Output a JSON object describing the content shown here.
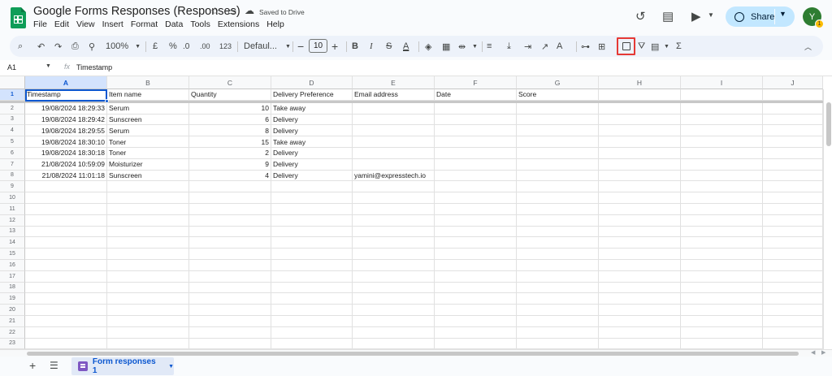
{
  "header": {
    "title": "Google Forms Responses (Responses)",
    "saved_status": "Saved to Drive",
    "share_label": "Share",
    "avatar_initial": "Y",
    "avatar_badge": "1",
    "menu": [
      "File",
      "Edit",
      "View",
      "Insert",
      "Format",
      "Data",
      "Tools",
      "Extensions",
      "Help"
    ]
  },
  "toolbar": {
    "zoom": "100%",
    "currency": "£",
    "percent": "%",
    "decimal_decrease": ".0",
    "decimal_increase": ".00",
    "more_formats": "123",
    "font_family": "Defaul...",
    "font_size": "10",
    "minus": "−",
    "plus": "+"
  },
  "formula_bar": {
    "cell_ref": "A1",
    "fx": "fx",
    "value": "Timestamp"
  },
  "grid": {
    "columns": [
      "A",
      "B",
      "C",
      "D",
      "E",
      "F",
      "G",
      "H",
      "I",
      "J"
    ],
    "headers": [
      "Timestamp",
      "Item name",
      "Quantity",
      "Delivery Preference",
      "Email address",
      "Date",
      "Score"
    ],
    "rows": [
      [
        "19/08/2024 18:29:33",
        "Serum",
        "10",
        "Take away",
        ""
      ],
      [
        "19/08/2024 18:29:42",
        "Sunscreen",
        "6",
        "Delivery",
        ""
      ],
      [
        "19/08/2024 18:29:55",
        "Serum",
        "8",
        "Delivery",
        ""
      ],
      [
        "19/08/2024 18:30:10",
        "Toner",
        "15",
        "Take away",
        ""
      ],
      [
        "19/08/2024 18:30:18",
        "Toner",
        "2",
        "Delivery",
        ""
      ],
      [
        "21/08/2024 10:59:09",
        "Moisturizer",
        "9",
        "Delivery",
        ""
      ],
      [
        "21/08/2024 11:01:18",
        "Sunscreen",
        "4",
        "Delivery",
        "yamini@expresstech.io"
      ]
    ],
    "row_numbers": [
      "1",
      "2",
      "3",
      "4",
      "5",
      "6",
      "7",
      "8",
      "9",
      "10",
      "11",
      "12",
      "13",
      "14",
      "15",
      "16",
      "17",
      "18",
      "19",
      "20",
      "21",
      "22",
      "23"
    ]
  },
  "sheet_tab": {
    "name": "Form responses 1"
  },
  "colors": {
    "accent": "#0b57d0",
    "share_bg": "#c2e7ff",
    "highlight_box": "#e53935",
    "logo": "#0f9d58"
  }
}
